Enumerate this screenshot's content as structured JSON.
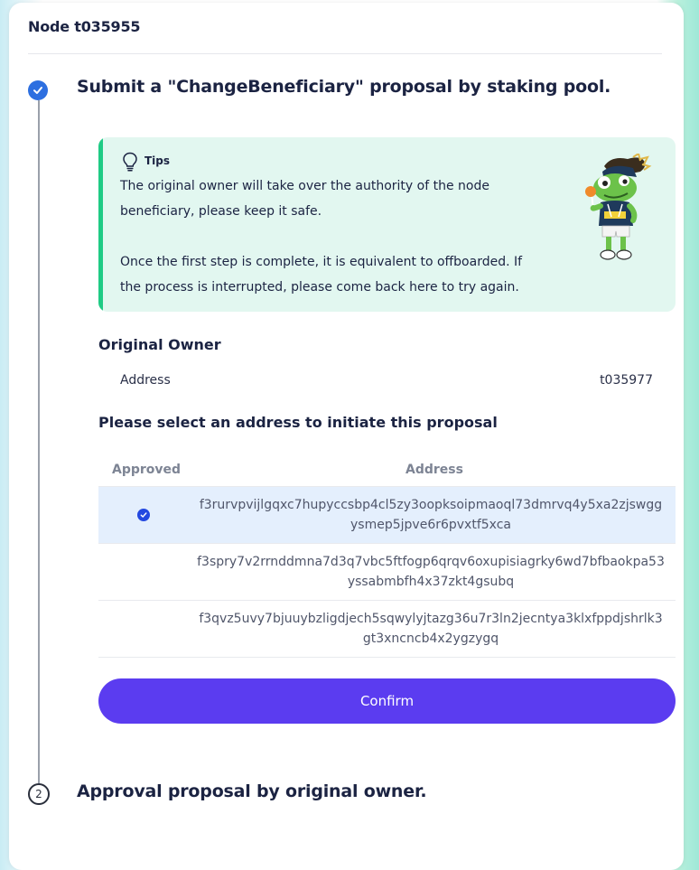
{
  "node": {
    "title": "Node t035955"
  },
  "step1": {
    "title": "Submit a \"ChangeBeneficiary\" proposal by staking pool."
  },
  "tips": {
    "label": "Tips",
    "line1": "The original owner will take over the authority of the node beneficiary, please keep it safe.",
    "line2": "Once the first step is complete, it is equivalent to offboarded. If the process is interrupted, please come back here to try again."
  },
  "original_owner": {
    "title": "Original Owner",
    "address_label": "Address",
    "address_value": "t035977"
  },
  "select": {
    "title": "Please select an address to initiate this proposal",
    "columns": [
      "Approved",
      "Address"
    ],
    "rows": [
      {
        "approved": true,
        "address": "f3rurvpvijlgqxc7hupyccsbp4cl5zy3oopksoipmaoql73dmrvq4y5xa2zjswggysmep5jpve6r6pvxtf5xca"
      },
      {
        "approved": false,
        "address": "f3spry7v2rrnddmna7d3q7vbc5ftfogp6qrqv6oxupisiagrky6wd7bfbaokpa53yssabmbfh4x37zkt4gsubq"
      },
      {
        "approved": false,
        "address": "f3qvz5uvy7bjuuybzligdjech5sqwylyjtazg36u7r3ln2jecntya3klxfppdjshrlk3gt3xncncb4x2ygzygq"
      }
    ]
  },
  "confirm": {
    "label": "Confirm"
  },
  "step2": {
    "number": "2",
    "title": "Approval proposal by original owner."
  },
  "colors": {
    "accent": "#5b3cf0",
    "step_done": "#2d6fe0",
    "tips_bg": "#e2f7f0",
    "tips_bar": "#1fcb85",
    "selected_row": "#e4effd"
  }
}
